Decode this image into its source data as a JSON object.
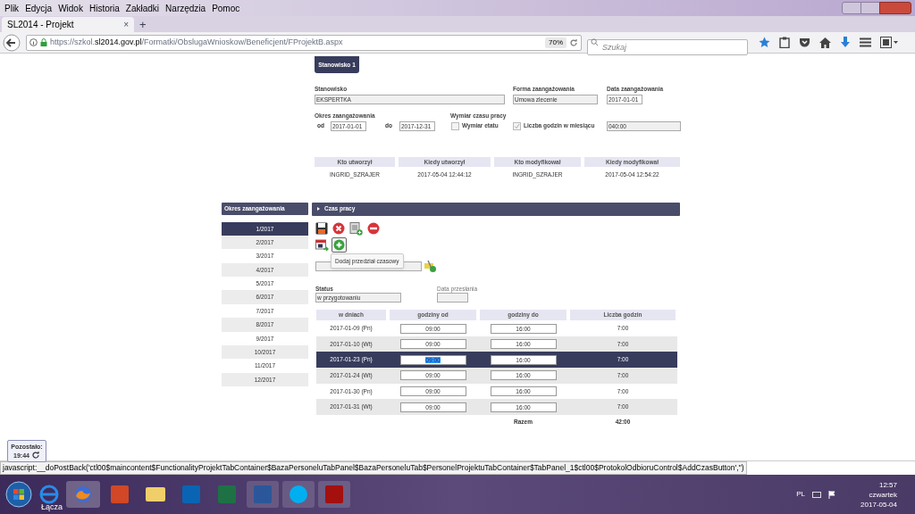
{
  "browser": {
    "menu": [
      "Plik",
      "Edycja",
      "Widok",
      "Historia",
      "Zakładki",
      "Narzędzia",
      "Pomoc"
    ],
    "tab": {
      "title": "SL2014 - Projekt",
      "close": "×"
    },
    "new_tab": "+",
    "url_prefix": "https://szkol.",
    "url_domain": "sl2014.gov.pl",
    "url_path": "/Formatki/ObslugaWnioskow/Beneficjent/FProjektB.aspx",
    "zoom": "70%",
    "search": {
      "placeholder": "Szukaj"
    }
  },
  "position_tab": {
    "label": "Stanowisko 1",
    "selected": true
  },
  "fields": [
    {
      "label": "Stanowisko",
      "value": "EKSPERTKA"
    },
    {
      "label": "Forma zaangażowania",
      "value": "Umowa zlecenie"
    },
    {
      "label": "Data zaangażowania",
      "value": "2017-01-01"
    }
  ],
  "period": {
    "label": "Okres zaangażowania",
    "from_label": "od",
    "from": "2017-01-01",
    "to_label": "do",
    "to": "2017-12-31"
  },
  "work_time": {
    "label": "Wymiar czasu pracy",
    "options": [
      {
        "label": "Wymiar etatu",
        "checked": false
      },
      {
        "label": "Liczba godzin w miesiącu",
        "checked": true
      }
    ],
    "hours": "040:00"
  },
  "audit": {
    "columns": [
      "Kto utworzył",
      "Kiedy utworzył",
      "Kto modyfikował",
      "Kiedy modyfikował"
    ],
    "row": [
      "INGRID_SZRAJER",
      "2017-05-04 12:44:12",
      "INGRID_SZRAJER",
      "2017-05-04 12:54:22"
    ]
  },
  "sidebar": {
    "title": "Okres zaangażowania",
    "items": [
      {
        "label": "1/2017",
        "selected": true
      },
      {
        "label": "2/2017",
        "selected": false
      },
      {
        "label": "3/2017",
        "selected": false
      },
      {
        "label": "4/2017",
        "selected": false
      },
      {
        "label": "5/2017",
        "selected": false
      },
      {
        "label": "6/2017",
        "selected": false
      },
      {
        "label": "7/2017",
        "selected": false
      },
      {
        "label": "8/2017",
        "selected": false
      },
      {
        "label": "9/2017",
        "selected": false
      },
      {
        "label": "10/2017",
        "selected": false
      },
      {
        "label": "11/2017",
        "selected": false
      },
      {
        "label": "12/2017",
        "selected": false
      }
    ]
  },
  "panel": {
    "title": "Czas pracy",
    "tooltip": "Dodaj przedział czasowy",
    "status_label": "Status",
    "status": "w przygotowaniu",
    "sent_label": "Data przesłania"
  },
  "schedule": {
    "columns": [
      "w dniach",
      "godziny od",
      "godziny do",
      "Liczba godzin"
    ],
    "rows": [
      {
        "day": "2017-01-09 (Pn)",
        "from": "09:00",
        "to": "16:00",
        "hours": "7:00",
        "selected": false
      },
      {
        "day": "2017-01-10 (Wt)",
        "from": "09:00",
        "to": "16:00",
        "hours": "7:00",
        "selected": false
      },
      {
        "day": "2017-01-23 (Pn)",
        "from": "09:00",
        "to": "16:00",
        "hours": "7:00",
        "selected": true
      },
      {
        "day": "2017-01-24 (Wt)",
        "from": "09:00",
        "to": "16:00",
        "hours": "7:00",
        "selected": false
      },
      {
        "day": "2017-01-30 (Pn)",
        "from": "09:00",
        "to": "16:00",
        "hours": "7:00",
        "selected": false
      },
      {
        "day": "2017-01-31 (Wt)",
        "from": "09:00",
        "to": "16:00",
        "hours": "7:00",
        "selected": false
      }
    ],
    "total_label": "Razem",
    "total": "42:00"
  },
  "session": {
    "label": "Pozostało:",
    "time": "19:44"
  },
  "status_bar": "javascript:__doPostBack('ctl00$maincontent$FunctionalityProjektTabContainer$BazaPersoneluTabPanel$BazaPersoneluTab$PersonelProjektuTabContainer$TabPanel_1$ctl00$ProtokolOdbioruControl$AddCzasButton','')",
  "taskbar": {
    "hover_label": "Łącza",
    "language": "PL",
    "time": "12:57",
    "weekday": "czwartek",
    "date": "2017-05-04"
  }
}
